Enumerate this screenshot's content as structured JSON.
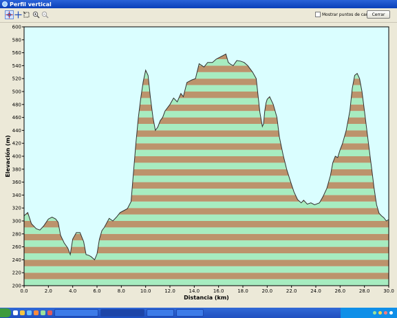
{
  "window": {
    "title": "Perfil vertical"
  },
  "toolbar": {
    "buttons": [
      {
        "name": "pan-tool-icon"
      },
      {
        "name": "crosshair-tool-icon"
      },
      {
        "name": "select-area-icon"
      },
      {
        "name": "zoom-in-icon"
      },
      {
        "name": "zoom-out-icon"
      }
    ],
    "show_waypoints_label": "Mostrar puntos de camino",
    "show_waypoints_checked": false,
    "close_label": "Cerrar"
  },
  "chart_data": {
    "type": "area",
    "xlabel": "Distancia  (km)",
    "ylabel": "Elevación (m)",
    "xlim": [
      0,
      30
    ],
    "ylim": [
      200,
      600
    ],
    "x_ticks": [
      "0.0",
      "2.0",
      "4.0",
      "6.0",
      "8.0",
      "10.0",
      "12.0",
      "14.0",
      "16.0",
      "18.0",
      "20.0",
      "22.0",
      "24.0",
      "26.0",
      "28.0",
      "30.0"
    ],
    "y_ticks": [
      "200",
      "220",
      "240",
      "260",
      "280",
      "300",
      "320",
      "340",
      "360",
      "380",
      "400",
      "420",
      "440",
      "460",
      "480",
      "500",
      "520",
      "540",
      "560",
      "580",
      "600"
    ],
    "band_colors": [
      "#a7ecc0",
      "#bc936c"
    ],
    "plot_background": "#dafeff",
    "series": [
      {
        "x": [
          0,
          0.3,
          0.6,
          1.0,
          1.3,
          1.6,
          2.0,
          2.3,
          2.6,
          2.8,
          3.0,
          3.3,
          3.6,
          3.8,
          4.0,
          4.3,
          4.6,
          4.9,
          5.1,
          5.3,
          5.5,
          5.8,
          6.0,
          6.2,
          6.4,
          6.6,
          6.8,
          7.0,
          7.3,
          7.6,
          7.9,
          8.2,
          8.5,
          8.8,
          9.0,
          9.2,
          9.4,
          9.6,
          9.8,
          10.0,
          10.2,
          10.4,
          10.6,
          10.8,
          11.0,
          11.2,
          11.4,
          11.6,
          12.0,
          12.3,
          12.6,
          12.9,
          13.1,
          13.4,
          13.8,
          14.1,
          14.4,
          14.8,
          15.1,
          15.5,
          15.8,
          16.0,
          16.3,
          16.6,
          16.8,
          17.0,
          17.2,
          17.5,
          17.8,
          18.1,
          18.4,
          18.8,
          19.1,
          19.4,
          19.6,
          19.7,
          19.8,
          19.9,
          20.0,
          20.2,
          20.5,
          20.8,
          21.0,
          21.3,
          21.6,
          21.9,
          22.2,
          22.5,
          22.8,
          23.0,
          23.3,
          23.6,
          23.9,
          24.3,
          24.6,
          24.9,
          25.2,
          25.4,
          25.6,
          25.8,
          26.0,
          26.2,
          26.5,
          26.8,
          27.0,
          27.2,
          27.4,
          27.6,
          27.8,
          28.0,
          28.2,
          28.4,
          28.6,
          28.8,
          29.0,
          29.2,
          29.4,
          29.6,
          29.8,
          30.0
        ],
        "y": [
          308,
          313,
          296,
          288,
          286,
          292,
          303,
          306,
          303,
          298,
          278,
          266,
          258,
          248,
          272,
          282,
          282,
          268,
          248,
          247,
          245,
          240,
          249,
          272,
          285,
          290,
          297,
          304,
          300,
          306,
          313,
          316,
          319,
          330,
          375,
          420,
          460,
          490,
          515,
          533,
          525,
          490,
          460,
          440,
          445,
          455,
          460,
          470,
          480,
          490,
          484,
          497,
          492,
          514,
          518,
          520,
          543,
          538,
          545,
          545,
          550,
          552,
          555,
          558,
          545,
          542,
          540,
          548,
          547,
          545,
          540,
          530,
          520,
          468,
          446,
          450,
          470,
          482,
          488,
          492,
          480,
          460,
          430,
          403,
          380,
          362,
          345,
          333,
          328,
          332,
          326,
          328,
          325,
          328,
          338,
          350,
          370,
          390,
          400,
          398,
          410,
          420,
          440,
          470,
          505,
          525,
          528,
          520,
          500,
          470,
          440,
          410,
          380,
          350,
          325,
          312,
          308,
          305,
          300,
          302
        ]
      }
    ]
  }
}
